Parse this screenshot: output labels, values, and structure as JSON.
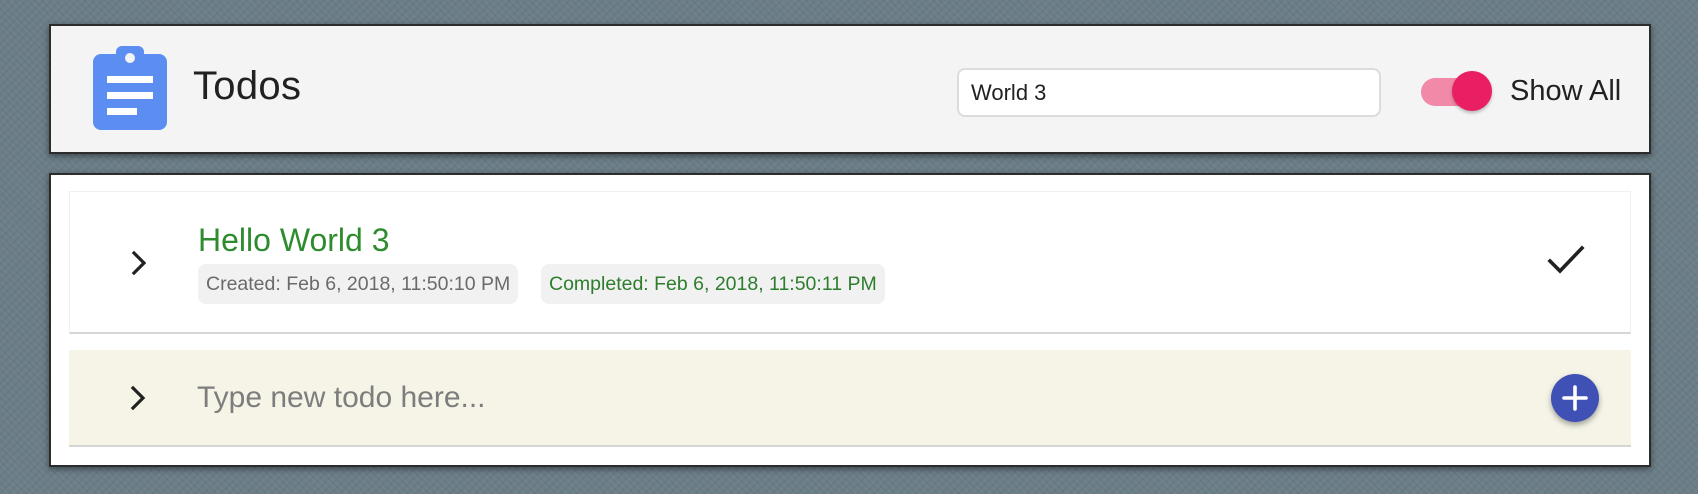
{
  "app": {
    "title": "Todos",
    "icon": "clipboard-icon",
    "icon_color": "#5b8ef0"
  },
  "search": {
    "value": "World 3",
    "placeholder": ""
  },
  "show_all": {
    "label": "Show All",
    "enabled": true,
    "accent_color": "#e91e63"
  },
  "todos": [
    {
      "title": "Hello World 3",
      "created": "Created: Feb 6, 2018, 11:50:10 PM",
      "completed": "Completed: Feb 6, 2018, 11:50:11 PM",
      "done": true,
      "expand_icon": "chevron-right-icon",
      "status_icon": "check-icon"
    }
  ],
  "new_todo": {
    "placeholder": "Type new todo here...",
    "value": "",
    "expand_icon": "chevron-right-icon",
    "add_icon": "plus-icon",
    "add_color": "#3f51b5"
  },
  "colors": {
    "completed_text": "#2e8b2e",
    "new_row_background": "#f5f4e6"
  }
}
